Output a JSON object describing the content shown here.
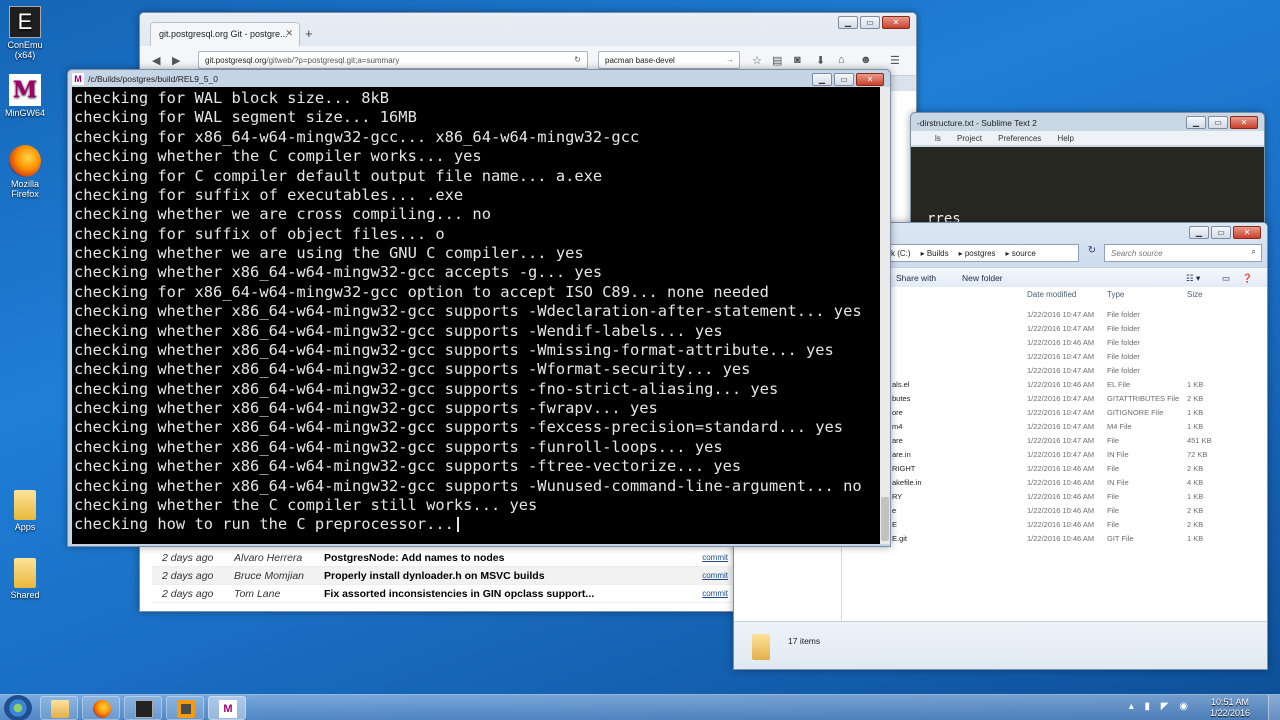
{
  "desktop": {
    "icons": [
      {
        "label": "ConEmu (x64)",
        "icon": "conemu-icon",
        "glyph": "E"
      },
      {
        "label": "MinGW64",
        "icon": "msys-icon",
        "glyph": "M"
      },
      {
        "label": "Mozilla Firefox",
        "icon": "firefox-icon"
      },
      {
        "label": "Apps",
        "icon": "folder-icon"
      },
      {
        "label": "Shared",
        "icon": "folder-icon"
      }
    ]
  },
  "firefox": {
    "tab_title": "git.postgresql.org Git - postgre...",
    "url_host": "git.postgresql.org",
    "url_path": "/gitweb/?p=postgresql.git;a=summary",
    "search_value": "pacman base-devel",
    "commits": [
      {
        "age": "2 days ago",
        "author": "Alvaro Herrera",
        "message": "PostgresNode: Add names to nodes",
        "link": "commit"
      },
      {
        "age": "2 days ago",
        "author": "Bruce Momjian",
        "message": "Properly install dynloader.h on MSVC builds",
        "link": "commit"
      },
      {
        "age": "2 days ago",
        "author": "Tom Lane",
        "message": "Fix assorted inconsistencies in GIN opclass support...",
        "link": "commit"
      }
    ]
  },
  "sublime": {
    "title": "-dirstructure.txt - Sublime Text 2",
    "menu": [
      "ls",
      "Project",
      "Preferences",
      "Help"
    ],
    "editor_text": "rres"
  },
  "explorer": {
    "breadcrumb": [
      "k (C:)",
      "Builds",
      "postgres",
      "source"
    ],
    "search_placeholder": "Search source",
    "toolbar": {
      "share": "Share with",
      "new_folder": "New folder"
    },
    "columns": {
      "date": "Date modified",
      "type": "Type",
      "size": "Size"
    },
    "rows": [
      {
        "name": "",
        "date": "1/22/2016 10:47 AM",
        "type": "File folder",
        "size": ""
      },
      {
        "name": "",
        "date": "1/22/2016 10:47 AM",
        "type": "File folder",
        "size": ""
      },
      {
        "name": "",
        "date": "1/22/2016 10:46 AM",
        "type": "File folder",
        "size": ""
      },
      {
        "name": "",
        "date": "1/22/2016 10:47 AM",
        "type": "File folder",
        "size": ""
      },
      {
        "name": "",
        "date": "1/22/2016 10:47 AM",
        "type": "File folder",
        "size": ""
      },
      {
        "name": "als.el",
        "date": "1/22/2016 10:46 AM",
        "type": "EL File",
        "size": "1 KB"
      },
      {
        "name": "butes",
        "date": "1/22/2016 10:47 AM",
        "type": "GITATTRIBUTES File",
        "size": "2 KB"
      },
      {
        "name": "ore",
        "date": "1/22/2016 10:47 AM",
        "type": "GITIGNORE File",
        "size": "1 KB"
      },
      {
        "name": "m4",
        "date": "1/22/2016 10:47 AM",
        "type": "M4 File",
        "size": "1 KB"
      },
      {
        "name": "are",
        "date": "1/22/2016 10:47 AM",
        "type": "File",
        "size": "451 KB"
      },
      {
        "name": "are.in",
        "date": "1/22/2016 10:47 AM",
        "type": "IN File",
        "size": "72 KB"
      },
      {
        "name": "RIGHT",
        "date": "1/22/2016 10:46 AM",
        "type": "File",
        "size": "2 KB"
      },
      {
        "name": "akefile.in",
        "date": "1/22/2016 10:46 AM",
        "type": "IN File",
        "size": "4 KB"
      },
      {
        "name": "RY",
        "date": "1/22/2016 10:46 AM",
        "type": "File",
        "size": "1 KB"
      },
      {
        "name": "e",
        "date": "1/22/2016 10:46 AM",
        "type": "File",
        "size": "2 KB"
      },
      {
        "name": "E",
        "date": "1/22/2016 10:46 AM",
        "type": "File",
        "size": "2 KB"
      },
      {
        "name": "E.git",
        "date": "1/22/2016 10:46 AM",
        "type": "GIT File",
        "size": "1 KB"
      }
    ],
    "status": "17 items"
  },
  "terminal": {
    "title": "/c/Builds/postgres/build/REL9_5_0",
    "lines": [
      "checking for WAL block size... 8kB",
      "checking for WAL segment size... 16MB",
      "checking for x86_64-w64-mingw32-gcc... x86_64-w64-mingw32-gcc",
      "checking whether the C compiler works... yes",
      "checking for C compiler default output file name... a.exe",
      "checking for suffix of executables... .exe",
      "checking whether we are cross compiling... no",
      "checking for suffix of object files... o",
      "checking whether we are using the GNU C compiler... yes",
      "checking whether x86_64-w64-mingw32-gcc accepts -g... yes",
      "checking for x86_64-w64-mingw32-gcc option to accept ISO C89... none needed",
      "checking whether x86_64-w64-mingw32-gcc supports -Wdeclaration-after-statement... yes",
      "checking whether x86_64-w64-mingw32-gcc supports -Wendif-labels... yes",
      "checking whether x86_64-w64-mingw32-gcc supports -Wmissing-format-attribute... yes",
      "checking whether x86_64-w64-mingw32-gcc supports -Wformat-security... yes",
      "checking whether x86_64-w64-mingw32-gcc supports -fno-strict-aliasing... yes",
      "checking whether x86_64-w64-mingw32-gcc supports -fwrapv... yes",
      "checking whether x86_64-w64-mingw32-gcc supports -fexcess-precision=standard... yes",
      "checking whether x86_64-w64-mingw32-gcc supports -funroll-loops... yes",
      "checking whether x86_64-w64-mingw32-gcc supports -ftree-vectorize... yes",
      "checking whether x86_64-w64-mingw32-gcc supports -Wunused-command-line-argument... no",
      "checking whether the C compiler still works... yes",
      "checking how to run the C preprocessor..."
    ]
  },
  "taskbar": {
    "time": "10:51 AM",
    "date": "1/22/2016",
    "apps": [
      "explorer-icon",
      "firefox-icon",
      "conemu-icon",
      "sublime-icon",
      "msys-icon"
    ]
  }
}
